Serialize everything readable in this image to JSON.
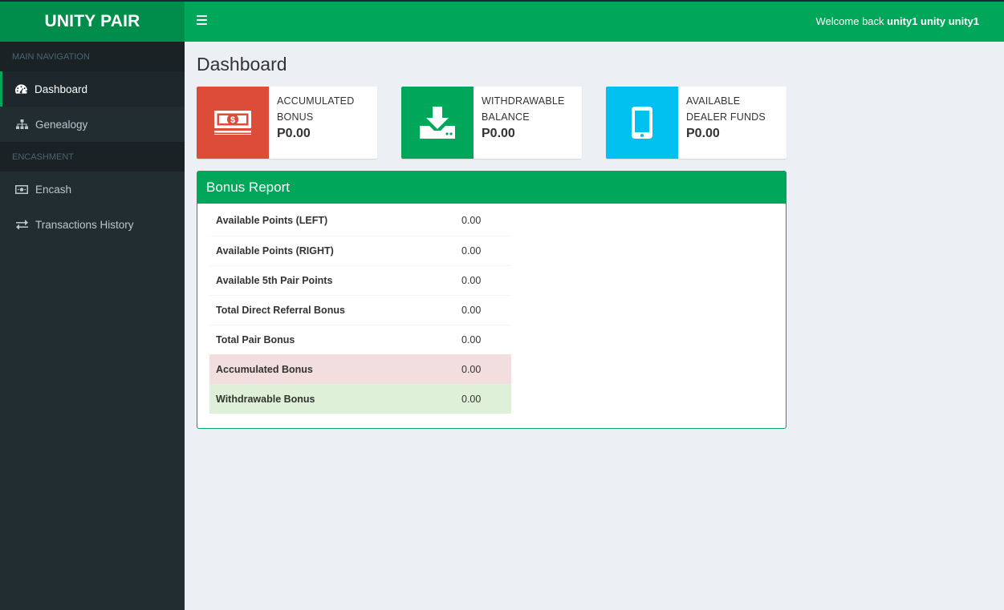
{
  "app": {
    "logo": "UNITY PAIR",
    "welcome_prefix": "Welcome back ",
    "welcome_user": "unity1 unity unity1"
  },
  "sidebar": {
    "sections": [
      {
        "header": "MAIN NAVIGATION"
      },
      {
        "header": "ENCASHMENT"
      }
    ],
    "items": [
      {
        "label": "Dashboard",
        "icon": "dashboard-icon",
        "active": true
      },
      {
        "label": "Genealogy",
        "icon": "sitemap-icon"
      },
      {
        "label": "Encash",
        "icon": "money-icon"
      },
      {
        "label": "Transactions History",
        "icon": "exchange-icon"
      }
    ]
  },
  "page": {
    "title": "Dashboard"
  },
  "info_boxes": [
    {
      "label_line1": "ACCUMULATED",
      "label_line2": "BONUS",
      "value": "P0.00",
      "color": "#dd4b39",
      "icon": "money-icon"
    },
    {
      "label_line1": "WITHDRAWABLE",
      "label_line2": "BALANCE",
      "value": "P0.00",
      "color": "#00a65a",
      "icon": "download-icon"
    },
    {
      "label_line1": "AVAILABLE",
      "label_line2": "DEALER FUNDS",
      "value": "P0.00",
      "color": "#00c0ef",
      "icon": "mobile-icon"
    }
  ],
  "bonus_report": {
    "title": "Bonus Report",
    "rows": [
      {
        "label": "Available Points (LEFT)",
        "value": "0.00"
      },
      {
        "label": "Available Points (RIGHT)",
        "value": "0.00"
      },
      {
        "label": "Available 5th Pair Points",
        "value": "0.00"
      },
      {
        "label": "Total Direct Referral Bonus",
        "value": "0.00"
      },
      {
        "label": "Total Pair Bonus",
        "value": "0.00"
      },
      {
        "label": "Accumulated Bonus",
        "value": "0.00",
        "status": "danger"
      },
      {
        "label": "Withdrawable Bonus",
        "value": "0.00",
        "status": "success"
      }
    ]
  },
  "colors": {
    "header_green": "#00a65a",
    "logo_green": "#008d4c",
    "sidebar_bg": "#222d32",
    "content_bg": "#ecf0f5"
  }
}
